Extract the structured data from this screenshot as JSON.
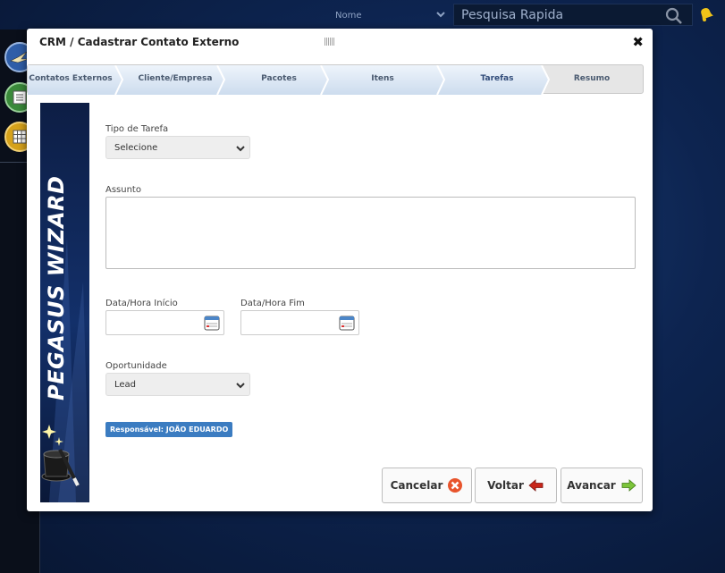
{
  "topbar": {
    "nome_label": "Nome",
    "search_placeholder": "Pesquisa Rapida"
  },
  "dialog": {
    "title": "CRM / Cadastrar Contato Externo",
    "grip": "||||||",
    "close": "✖"
  },
  "steps": [
    {
      "label": "Contatos Externos"
    },
    {
      "label": "Cliente/Empresa"
    },
    {
      "label": "Pacotes"
    },
    {
      "label": "Itens"
    },
    {
      "label": "Tarefas"
    },
    {
      "label": "Resumo"
    }
  ],
  "banner": {
    "text": "PEGASUS WIZARD"
  },
  "form": {
    "tipo_tarefa_label": "Tipo de Tarefa",
    "tipo_tarefa_value": "Selecione",
    "assunto_label": "Assunto",
    "data_inicio_label": "Data/Hora Início",
    "data_fim_label": "Data/Hora Fim",
    "oportunidade_label": "Oportunidade",
    "oportunidade_value": "Lead",
    "responsavel": "Responsável: JOÃO EDUARDO"
  },
  "buttons": {
    "cancelar": "Cancelar",
    "voltar": "Voltar",
    "avancar": "Avancar"
  },
  "colors": {
    "active_step": "#2f4a78",
    "step_blue": "#d9e7f7",
    "badge": "#3b7cc1",
    "bell": "#f0c419"
  }
}
